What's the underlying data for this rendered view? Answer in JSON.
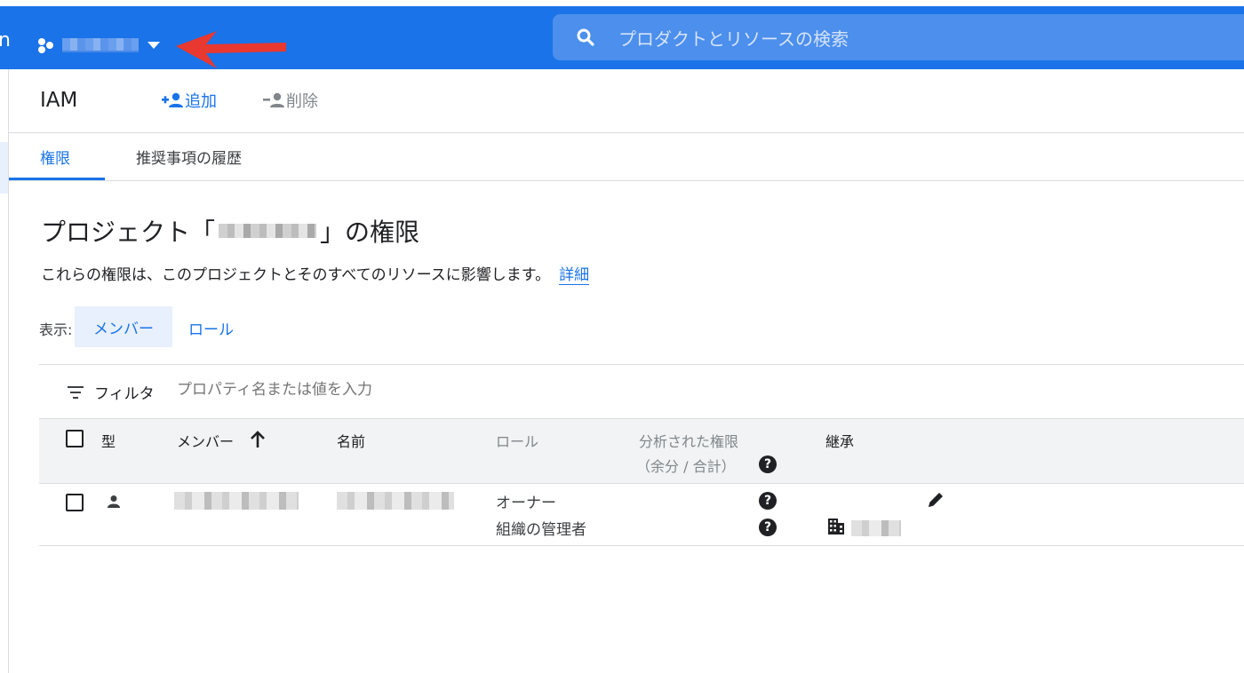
{
  "topbar": {
    "brand_fragment": "n",
    "project_icon": "project-hexagon-icon",
    "caret_icon": "caret-down-icon",
    "search_placeholder": "プロダクトとリソースの検索",
    "color": "#1a73e8"
  },
  "header": {
    "title": "IAM",
    "add_label": "追加",
    "delete_label": "削除"
  },
  "tabs": [
    {
      "label": "権限",
      "active": true
    },
    {
      "label": "推奨事項の履歴",
      "active": false
    }
  ],
  "section": {
    "title_prefix": "プロジェクト「",
    "title_suffix": "」の権限",
    "description": "これらの権限は、このプロジェクトとそのすべてのリソースに影響します。",
    "learn_more": "詳細"
  },
  "view": {
    "label": "表示:",
    "member": "メンバー",
    "role": "ロール"
  },
  "filter": {
    "label": "フィルタ",
    "placeholder": "プロパティ名または値を入力"
  },
  "table": {
    "columns": {
      "type": "型",
      "member": "メンバー",
      "name": "名前",
      "role": "ロール",
      "analyzed": "分析された権限",
      "analyzed_sub": "（余分 / 合計）",
      "inherit": "継承"
    },
    "rows": [
      {
        "roles": [
          "オーナー",
          "組織の管理者"
        ]
      }
    ]
  },
  "help_glyph": "?"
}
